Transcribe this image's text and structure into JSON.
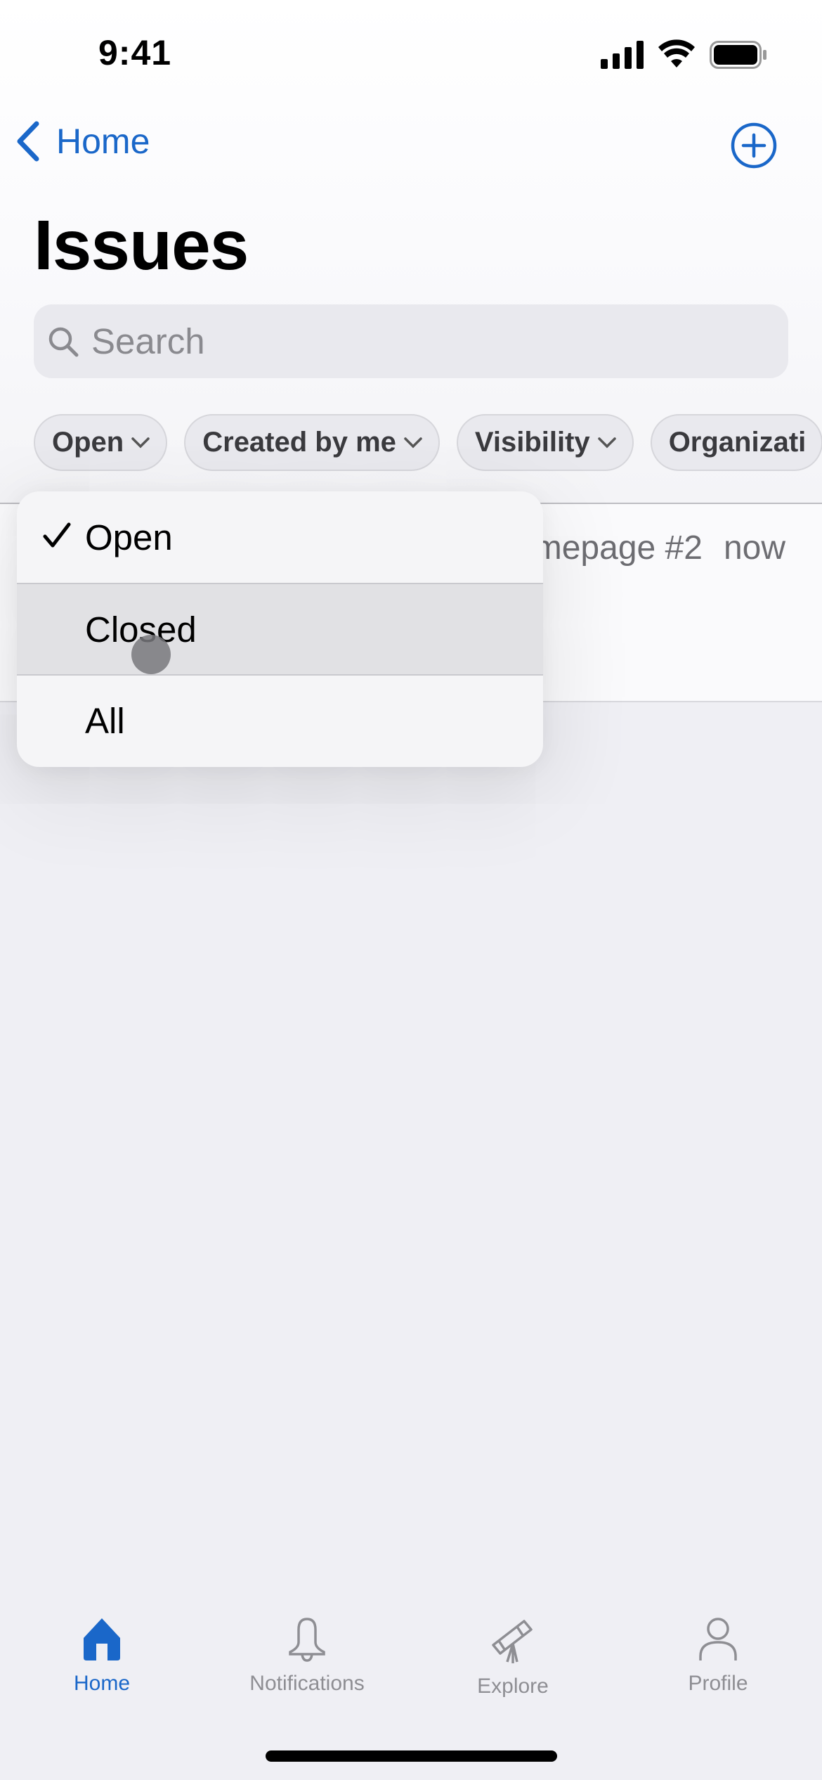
{
  "status_bar": {
    "time": "9:41"
  },
  "nav": {
    "back_label": "Home",
    "add_icon": "plus-circle-icon"
  },
  "page": {
    "title": "Issues"
  },
  "search": {
    "placeholder": "Search",
    "value": ""
  },
  "filters": [
    {
      "label": "Open"
    },
    {
      "label": "Created by me"
    },
    {
      "label": "Visibility"
    },
    {
      "label": "Organizati"
    }
  ],
  "list": {
    "items": [
      {
        "title_fragment": "mepage #2",
        "time": "now"
      }
    ]
  },
  "dropdown": {
    "items": [
      {
        "label": "Open",
        "checked": true
      },
      {
        "label": "Closed",
        "checked": false,
        "highlighted": true
      },
      {
        "label": "All",
        "checked": false
      }
    ]
  },
  "tabbar": {
    "items": [
      {
        "label": "Home",
        "icon": "house-icon",
        "active": true
      },
      {
        "label": "Notifications",
        "icon": "bell-icon",
        "active": false
      },
      {
        "label": "Explore",
        "icon": "telescope-icon",
        "active": false
      },
      {
        "label": "Profile",
        "icon": "person-icon",
        "active": false
      }
    ]
  },
  "colors": {
    "accent": "#1a67c9",
    "inactive": "#8e8e93",
    "background": "#efeff4"
  }
}
